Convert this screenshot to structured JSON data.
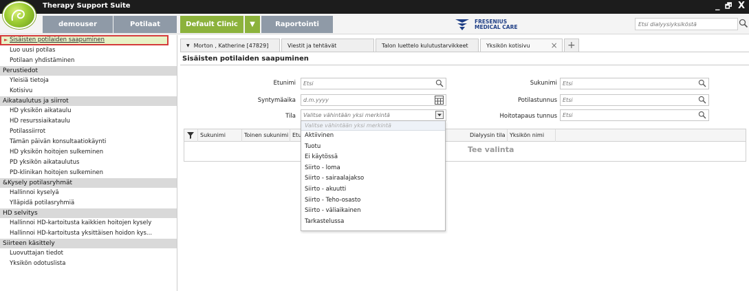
{
  "app": {
    "title": "Therapy Support Suite"
  },
  "window": {
    "minimize": "_",
    "restore": "🗗",
    "close": "X"
  },
  "header": {
    "user": "demouser",
    "patients": "Potilaat",
    "clinic": "Default Clinic",
    "clinic_toggle": "▼",
    "reports": "Raportointi",
    "brand_line1": "FRESENIUS",
    "brand_line2": "MEDICAL CARE",
    "search_placeholder": "Etsi dialyysiyksiköstä"
  },
  "sidebar": {
    "items": [
      {
        "type": "item",
        "label": "Sisäisten potilaiden saapuminen",
        "active": true
      },
      {
        "type": "item",
        "label": "Luo uusi potilas"
      },
      {
        "type": "item",
        "label": "Potilaan yhdistäminen"
      },
      {
        "type": "group",
        "label": "Perustiedot"
      },
      {
        "type": "item",
        "label": "Yleisiä tietoja"
      },
      {
        "type": "item",
        "label": "Kotisivu"
      },
      {
        "type": "group",
        "label": "Aikataulutus ja siirrot"
      },
      {
        "type": "item",
        "label": "HD yksikön aikataulu"
      },
      {
        "type": "item",
        "label": "HD resurssiaikataulu"
      },
      {
        "type": "item",
        "label": "Potilassiirrot"
      },
      {
        "type": "item",
        "label": "Tämän päivän konsultaatiokäynti"
      },
      {
        "type": "item",
        "label": "HD yksikön hoitojen sulkeminen"
      },
      {
        "type": "item",
        "label": "PD yksikön aikataulutus"
      },
      {
        "type": "item",
        "label": "PD-klinikan hoitojen sulkeminen"
      },
      {
        "type": "group",
        "label": "&Kysely  potilasryhmät"
      },
      {
        "type": "item",
        "label": "Hallinnoi kyselyä"
      },
      {
        "type": "item",
        "label": "Ylläpidä potilasryhmiä"
      },
      {
        "type": "group",
        "label": "HD selvitys"
      },
      {
        "type": "item",
        "label": "Hallinnoi HD-kartoitusta kaikkien hoitojen kysely"
      },
      {
        "type": "item",
        "label": "Hallinnoi HD-kartoitusta yksittäisen hoidon kys..."
      },
      {
        "type": "group",
        "label": "Siirteen käsittely"
      },
      {
        "type": "item",
        "label": "Luovuttajan tiedot"
      },
      {
        "type": "item",
        "label": "Yksikön odotuslista"
      }
    ]
  },
  "tabs": {
    "items": [
      {
        "label": "Morton , Katherine [47829]",
        "marker": "▼"
      },
      {
        "label": "Viestit ja tehtävät"
      },
      {
        "label": "Talon luettelo kulutustarvikkeet"
      },
      {
        "label": "Yksikön kotisivu",
        "active": true,
        "close": "×"
      }
    ],
    "add": "+"
  },
  "main": {
    "title": "Sisäisten potilaiden saapuminen",
    "form": {
      "first_name_label": "Etunimi",
      "first_name_placeholder": "Etsi",
      "dob_label": "Syntymäaika",
      "dob_placeholder": "d.m.yyyy",
      "status_label": "Tila",
      "status_placeholder": "Valitse vähintään yksi merkintä",
      "last_name_label": "Sukunimi",
      "last_name_placeholder": "Etsi",
      "patient_id_label": "Potilastunnus",
      "patient_id_placeholder": "Etsi",
      "treatment_id_label": "Hoitotapaus tunnus",
      "treatment_id_placeholder": "Etsi"
    },
    "grid": {
      "columns": [
        "Sukunimi",
        "Toinen sukunimi",
        "Etunim",
        "Dialyysin tila",
        "Yksikön nimi"
      ],
      "empty_text": "Tee valinta"
    },
    "status_dropdown": {
      "placeholder": "Valitse vähintään yksi merkintä",
      "options": [
        "Aktiivinen",
        "Tuotu",
        "Ei käytössä",
        "Siirto - loma",
        "Siirto - sairaalajakso",
        "Siirto - akuutti",
        "Siirto - Teho-osasto",
        "Siirto - väliaikainen",
        "Tarkastelussa"
      ]
    }
  },
  "colors": {
    "accent_green": "#8cb23c",
    "header_gray": "#8f9aa7",
    "active_border": "#d43a3a",
    "brand_blue": "#1f3f86"
  }
}
